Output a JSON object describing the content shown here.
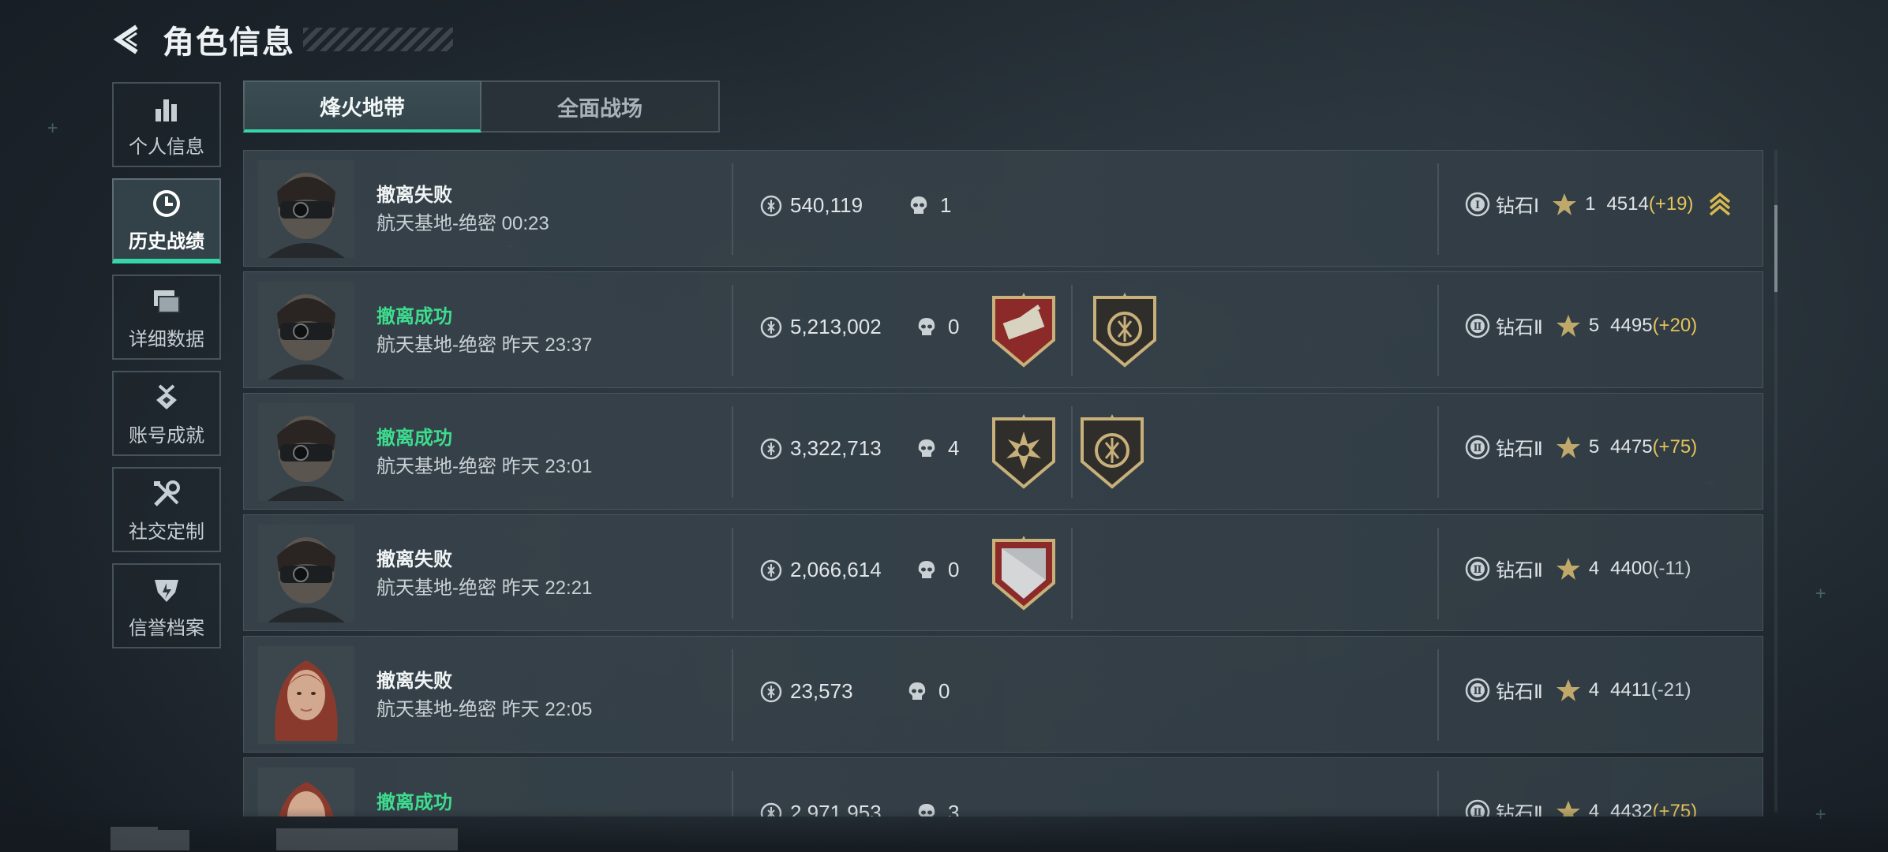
{
  "header": {
    "title": "角色信息"
  },
  "sidebar": {
    "items": [
      {
        "label": "个人信息",
        "icon": "bar-chart-icon"
      },
      {
        "label": "历史战绩",
        "icon": "clock-icon"
      },
      {
        "label": "详细数据",
        "icon": "cards-icon"
      },
      {
        "label": "账号成就",
        "icon": "achievement-icon"
      },
      {
        "label": "社交定制",
        "icon": "tools-icon"
      },
      {
        "label": "信誉档案",
        "icon": "credit-icon"
      }
    ],
    "active_index": 1
  },
  "tabs": [
    {
      "label": "烽火地带"
    },
    {
      "label": "全面战场"
    }
  ],
  "records": [
    {
      "status": "撤离失败",
      "map": "航天基地-绝密",
      "time": "00:23",
      "value": "540,119",
      "kills": "1",
      "rank_roman": "Ⅰ",
      "rank": "钻石Ⅰ",
      "stars": "1",
      "score": "4514",
      "delta": "(+19)"
    },
    {
      "status": "撤离成功",
      "map": "航天基地-绝密",
      "time": "昨天 23:37",
      "value": "5,213,002",
      "kills": "0",
      "rank_roman": "Ⅱ",
      "rank": "钻石Ⅱ",
      "stars": "5",
      "score": "4495",
      "delta": "(+20)"
    },
    {
      "status": "撤离成功",
      "map": "航天基地-绝密",
      "time": "昨天 23:01",
      "value": "3,322,713",
      "kills": "4",
      "rank_roman": "Ⅱ",
      "rank": "钻石Ⅱ",
      "stars": "5",
      "score": "4475",
      "delta": "(+75)"
    },
    {
      "status": "撤离失败",
      "map": "航天基地-绝密",
      "time": "昨天 22:21",
      "value": "2,066,614",
      "kills": "0",
      "rank_roman": "Ⅱ",
      "rank": "钻石Ⅱ",
      "stars": "4",
      "score": "4400",
      "delta": "(-11)"
    },
    {
      "status": "撤离失败",
      "map": "航天基地-绝密",
      "time": "昨天 22:05",
      "value": "23,573",
      "kills": "0",
      "rank_roman": "Ⅱ",
      "rank": "钻石Ⅱ",
      "stars": "4",
      "score": "4411",
      "delta": "(-21)"
    },
    {
      "status": "撤离成功",
      "map": "",
      "time": "",
      "value": "2,971,953",
      "kills": "3",
      "rank_roman": "Ⅱ",
      "rank": "钻石Ⅱ",
      "stars": "4",
      "score": "4432",
      "delta": "(+75)"
    }
  ],
  "colors": {
    "accent": "#35d7a6",
    "success": "#3ddc8e",
    "gain": "#e3c35a"
  }
}
